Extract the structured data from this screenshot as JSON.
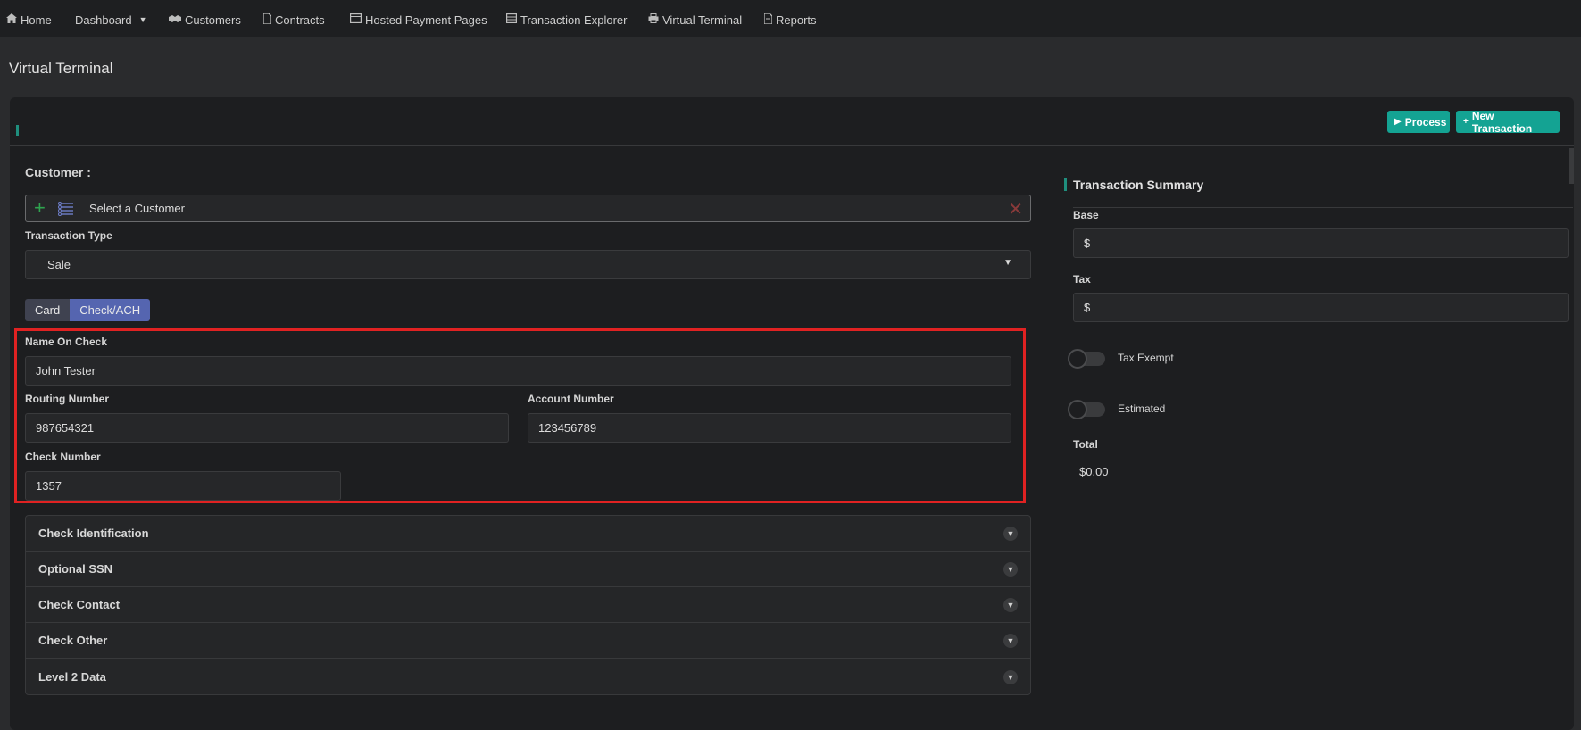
{
  "nav": {
    "items": [
      {
        "icon": "home-icon",
        "label": "Home"
      },
      {
        "icon": "dashboard-icon",
        "label": "Dashboard"
      },
      {
        "icon": "handshake-icon",
        "label": "Customers"
      },
      {
        "icon": "file-icon",
        "label": "Contracts"
      },
      {
        "icon": "window-icon",
        "label": "Hosted Payment Pages"
      },
      {
        "icon": "table-icon",
        "label": "Transaction Explorer"
      },
      {
        "icon": "printer-icon",
        "label": "Virtual Terminal"
      },
      {
        "icon": "report-icon",
        "label": "Reports"
      }
    ]
  },
  "page": {
    "title": "Virtual Terminal"
  },
  "toolbar": {
    "process_label": "Process",
    "new_transaction_label": "New Transaction"
  },
  "form": {
    "customer_label": "Customer :",
    "customer_placeholder": "Select a Customer",
    "transaction_type_label": "Transaction Type",
    "transaction_type_value": "Sale",
    "tabs": [
      {
        "label": "Card"
      },
      {
        "label": "Check/ACH"
      }
    ],
    "active_tab": "Check/ACH",
    "name_on_check_label": "Name On Check",
    "name_on_check_value": "John Tester",
    "routing_number_label": "Routing Number",
    "routing_number_value": "987654321",
    "account_number_label": "Account Number",
    "account_number_value": "123456789",
    "check_number_label": "Check Number",
    "check_number_value": "1357"
  },
  "accordion": {
    "sections": [
      {
        "label": "Check Identification"
      },
      {
        "label": "Optional SSN"
      },
      {
        "label": "Check Contact"
      },
      {
        "label": "Check Other"
      },
      {
        "label": "Level 2 Data"
      }
    ]
  },
  "summary": {
    "title": "Transaction Summary",
    "base_label": "Base",
    "base_prefix": "$",
    "tax_label": "Tax",
    "tax_prefix": "$",
    "tax_exempt_label": "Tax Exempt",
    "estimated_label": "Estimated",
    "total_label": "Total",
    "total_value": "$0.00"
  },
  "colors": {
    "accent": "#14a393",
    "tab_active": "#5565b0",
    "highlight": "#e02222"
  }
}
